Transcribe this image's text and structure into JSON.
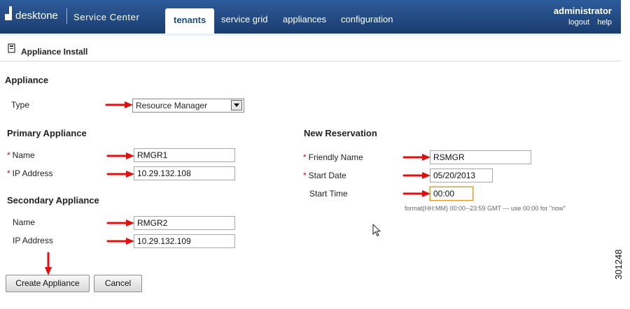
{
  "header": {
    "logo_text": "desktone",
    "product": "Service Center",
    "tabs": [
      {
        "label": "tenants",
        "active": true
      },
      {
        "label": "service grid",
        "active": false
      },
      {
        "label": "appliances",
        "active": false
      },
      {
        "label": "configuration",
        "active": false
      }
    ],
    "user": "administrator",
    "logout": "logout",
    "help": "help"
  },
  "page": {
    "title": "Appliance Install"
  },
  "appliance": {
    "heading": "Appliance",
    "type_label": "Type",
    "type_value": "Resource Manager"
  },
  "primary": {
    "heading": "Primary Appliance",
    "name_label": "Name",
    "name_value": "RMGR1",
    "ip_label": "IP Address",
    "ip_value": "10.29.132.108"
  },
  "secondary": {
    "heading": "Secondary Appliance",
    "name_label": "Name",
    "name_value": "RMGR2",
    "ip_label": "IP Address",
    "ip_value": "10.29.132.109"
  },
  "reservation": {
    "heading": "New Reservation",
    "friendly_label": "Friendly Name",
    "friendly_value": "RSMGR",
    "date_label": "Start Date",
    "date_value": "05/20/2013",
    "time_label": "Start Time",
    "time_value": "00:00",
    "hint": "format(HH:MM) 00:00--23:59 GMT --- use 00:00 for \"now\""
  },
  "buttons": {
    "create": "Create Appliance",
    "cancel": "Cancel"
  },
  "required_mark": "*",
  "figure_id": "301248",
  "colors": {
    "header": "#1f4680",
    "arrow": "#e01010",
    "required": "#d01010"
  }
}
